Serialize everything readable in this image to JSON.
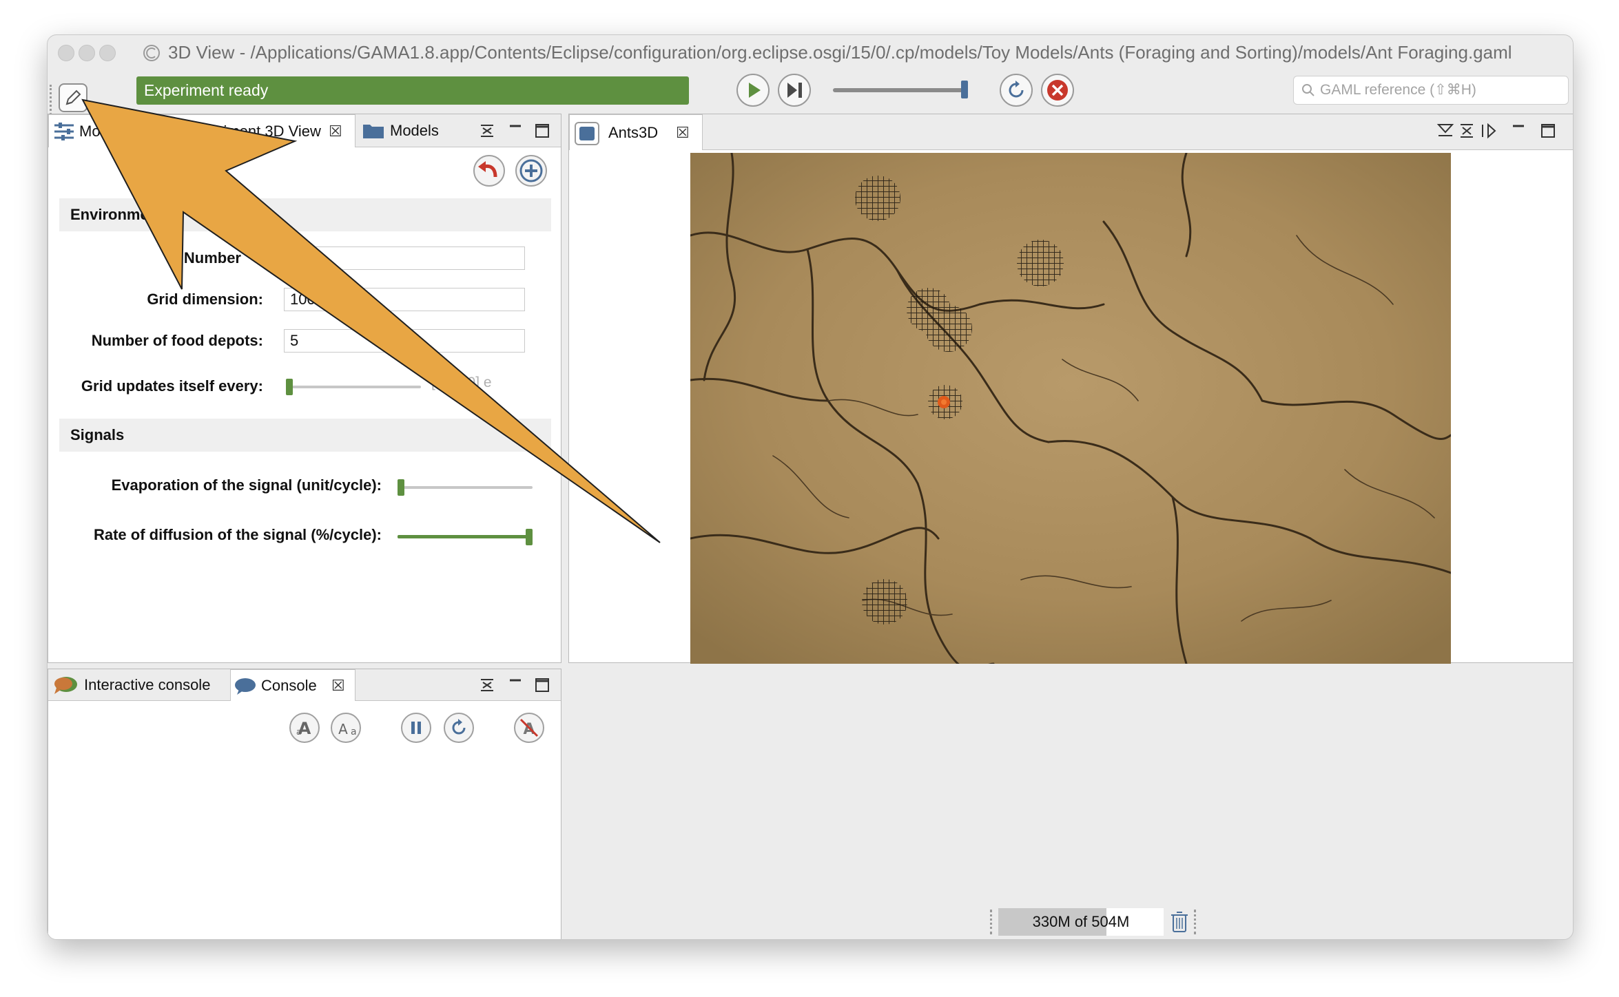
{
  "window": {
    "title": "3D View - /Applications/GAMA1.8.app/Contents/Eclipse/configuration/org.eclipse.osgi/15/0/.cp/models/Toy Models/Ants (Foraging and Sorting)/models/Ant Foraging.gaml"
  },
  "toolbar": {
    "status": "Experiment ready",
    "search_placeholder": "GAML reference (⇧⌘H)",
    "speed_level": 1.0
  },
  "left_panel": {
    "tabs": [
      {
        "label": "Modeling"
      },
      {
        "label": "Experiment 3D View"
      },
      {
        "label": "Models"
      }
    ],
    "sections": {
      "environment": "Environment",
      "signals": "Signals"
    },
    "params": {
      "number_label": "Number",
      "grid_dimension_label": "Grid dimension:",
      "grid_dimension_value": "100",
      "food_depots_label": "Number of food depots:",
      "food_depots_value": "5",
      "grid_updates_label": "Grid updates itself every:",
      "grid_updates_range": "[0..100] e",
      "grid_updates_level": 0.0,
      "evaporation_label": "Evaporation of the signal (unit/cycle):",
      "evaporation_level": 0.0,
      "diffusion_label": "Rate of diffusion of the signal (%/cycle):",
      "diffusion_level": 1.0
    }
  },
  "console_panel": {
    "tabs": [
      {
        "label": "Interactive console"
      },
      {
        "label": "Console"
      }
    ]
  },
  "display_panel": {
    "tab": "Ants3D"
  },
  "statusbar": {
    "memory": "330M of 504M",
    "memory_fraction": 0.655
  },
  "colors": {
    "accent_green": "#5e9040",
    "arrow_orange": "#e8a644",
    "stop_red": "#c8382c"
  }
}
